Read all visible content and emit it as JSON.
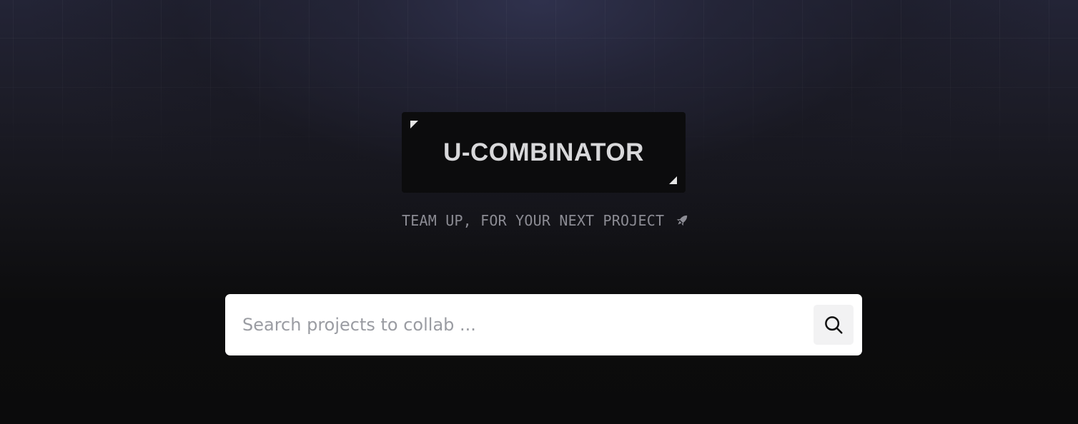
{
  "brand": {
    "logo_text": "U-COMBINATOR",
    "tagline": "TEAM UP, FOR YOUR NEXT PROJECT",
    "tagline_icon": "rocket-icon"
  },
  "search": {
    "placeholder": "Search projects to collab ...",
    "value": "",
    "button_icon": "search-icon"
  },
  "colors": {
    "background_top": "#232436",
    "background_bottom": "#0b0b0c",
    "logo_box": "#0c0c0d",
    "logo_text": "#d8d8da",
    "tagline": "#8c8c94",
    "search_bg": "#ffffff",
    "search_button_bg": "#f2f2f3"
  }
}
